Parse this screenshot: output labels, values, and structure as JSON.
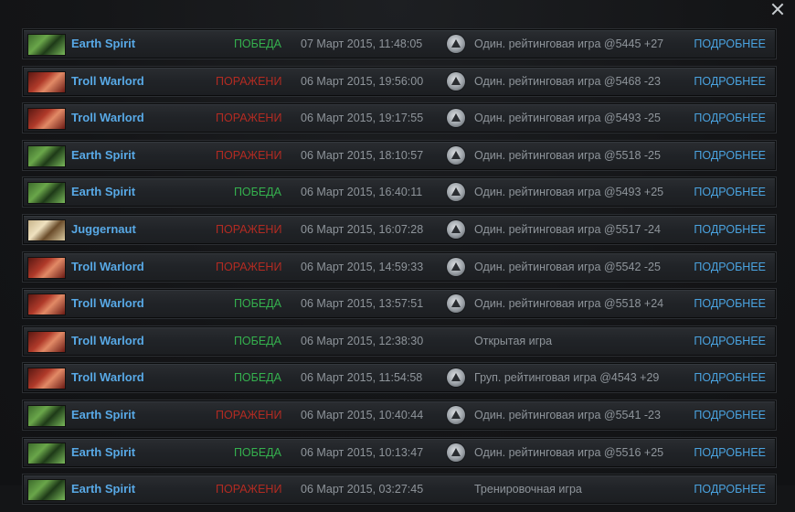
{
  "colors": {
    "win": "#35b14e",
    "loss": "#b32b22",
    "hero_name": "#58a9e6",
    "details_link": "#4aa3e0",
    "text_muted": "#8f959b"
  },
  "close_icon": "close-icon",
  "matches": [
    {
      "hero": "Earth Spirit",
      "hero_icon": "earth",
      "result": "ПОБЕДА",
      "win": true,
      "date": "07 Март 2015, 11:48:05",
      "ranked": true,
      "mode": "Один. рейтинговая игра @5445 +27",
      "details": "ПОДРОБНЕЕ"
    },
    {
      "hero": "Troll Warlord",
      "hero_icon": "troll",
      "result": "ПОРАЖЕНИ",
      "win": false,
      "date": "06 Март 2015, 19:56:00",
      "ranked": true,
      "mode": "Один. рейтинговая игра @5468 -23",
      "details": "ПОДРОБНЕЕ"
    },
    {
      "hero": "Troll Warlord",
      "hero_icon": "troll",
      "result": "ПОРАЖЕНИ",
      "win": false,
      "date": "06 Март 2015, 19:17:55",
      "ranked": true,
      "mode": "Один. рейтинговая игра @5493 -25",
      "details": "ПОДРОБНЕЕ"
    },
    {
      "hero": "Earth Spirit",
      "hero_icon": "earth",
      "result": "ПОРАЖЕНИ",
      "win": false,
      "date": "06 Март 2015, 18:10:57",
      "ranked": true,
      "mode": "Один. рейтинговая игра @5518 -25",
      "details": "ПОДРОБНЕЕ"
    },
    {
      "hero": "Earth Spirit",
      "hero_icon": "earth",
      "result": "ПОБЕДА",
      "win": true,
      "date": "06 Март 2015, 16:40:11",
      "ranked": true,
      "mode": "Один. рейтинговая игра @5493 +25",
      "details": "ПОДРОБНЕЕ"
    },
    {
      "hero": "Juggernaut",
      "hero_icon": "jugg",
      "result": "ПОРАЖЕНИ",
      "win": false,
      "date": "06 Март 2015, 16:07:28",
      "ranked": true,
      "mode": "Один. рейтинговая игра @5517 -24",
      "details": "ПОДРОБНЕЕ"
    },
    {
      "hero": "Troll Warlord",
      "hero_icon": "troll",
      "result": "ПОРАЖЕНИ",
      "win": false,
      "date": "06 Март 2015, 14:59:33",
      "ranked": true,
      "mode": "Один. рейтинговая игра @5542 -25",
      "details": "ПОДРОБНЕЕ"
    },
    {
      "hero": "Troll Warlord",
      "hero_icon": "troll",
      "result": "ПОБЕДА",
      "win": true,
      "date": "06 Март 2015, 13:57:51",
      "ranked": true,
      "mode": "Один. рейтинговая игра @5518 +24",
      "details": "ПОДРОБНЕЕ"
    },
    {
      "hero": "Troll Warlord",
      "hero_icon": "troll",
      "result": "ПОБЕДА",
      "win": true,
      "date": "06 Март 2015, 12:38:30",
      "ranked": false,
      "mode": "Открытая игра",
      "details": "ПОДРОБНЕЕ"
    },
    {
      "hero": "Troll Warlord",
      "hero_icon": "troll",
      "result": "ПОБЕДА",
      "win": true,
      "date": "06 Март 2015, 11:54:58",
      "ranked": true,
      "mode": "Груп. рейтинговая игра @4543 +29",
      "details": "ПОДРОБНЕЕ"
    },
    {
      "hero": "Earth Spirit",
      "hero_icon": "earth",
      "result": "ПОРАЖЕНИ",
      "win": false,
      "date": "06 Март 2015, 10:40:44",
      "ranked": true,
      "mode": "Один. рейтинговая игра @5541 -23",
      "details": "ПОДРОБНЕЕ"
    },
    {
      "hero": "Earth Spirit",
      "hero_icon": "earth",
      "result": "ПОБЕДА",
      "win": true,
      "date": "06 Март 2015, 10:13:47",
      "ranked": true,
      "mode": "Один. рейтинговая игра @5516 +25",
      "details": "ПОДРОБНЕЕ"
    },
    {
      "hero": "Earth Spirit",
      "hero_icon": "earth",
      "result": "ПОРАЖЕНИ",
      "win": false,
      "date": "06 Март 2015, 03:27:45",
      "ranked": false,
      "mode": "Тренировочная игра",
      "details": "ПОДРОБНЕЕ"
    }
  ]
}
